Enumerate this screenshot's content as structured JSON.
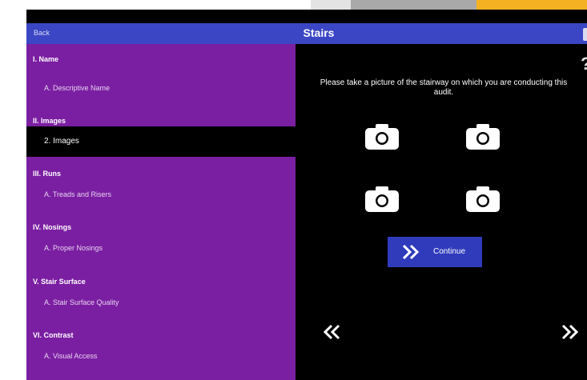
{
  "header": {
    "back_label": "Back",
    "title": "Stairs"
  },
  "sidebar": {
    "sections": [
      {
        "heading": "I. Name",
        "items": [
          "A. Descriptive Name"
        ]
      },
      {
        "heading": "II. Images",
        "items": [
          "2. Images"
        ]
      },
      {
        "heading": "III. Runs",
        "items": [
          "A. Treads and Risers"
        ]
      },
      {
        "heading": "IV. Nosings",
        "items": [
          "A. Proper Nosings"
        ]
      },
      {
        "heading": "V. Stair Surface",
        "items": [
          "A. Stair Surface Quality"
        ]
      },
      {
        "heading": "VI. Contrast",
        "items": [
          "A. Visual Access"
        ]
      }
    ],
    "selected_item": "2. Images"
  },
  "main": {
    "prompt": "Please take a picture of the stairway on which you are conducting this audit.",
    "continue_label": "Continue",
    "help_symbol": "?"
  },
  "icons": {
    "camera": "camera-icon",
    "continue": "double-chevron-right-icon",
    "prev": "double-chevron-left-icon",
    "next": "double-chevron-right-icon"
  },
  "colors": {
    "header": "#3a46c4",
    "sidebar": "#7b1fa2",
    "selected": "#000000",
    "continue": "#2f3bbb",
    "accent_top": "#f4b223"
  }
}
